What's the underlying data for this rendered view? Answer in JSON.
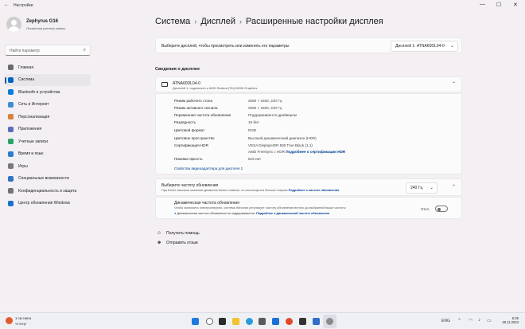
{
  "window": {
    "title": "Настройки",
    "back_glyph": "←",
    "controls": [
      "—",
      "☐",
      "✕"
    ]
  },
  "profile": {
    "name": "Zephyrus G16",
    "account_type": "Локальная учетная запись"
  },
  "search": {
    "placeholder": "Найти параметр"
  },
  "nav": [
    {
      "label": "Главная",
      "icon": "home-icon",
      "color": "#6b6b6b"
    },
    {
      "label": "Система",
      "icon": "system-icon",
      "color": "#0067c0",
      "active": true
    },
    {
      "label": "Bluetooth и устройства",
      "icon": "bluetooth-icon",
      "color": "#0a7bd6"
    },
    {
      "label": "Сеть и Интернет",
      "icon": "network-icon",
      "color": "#3b8fd6"
    },
    {
      "label": "Персонализация",
      "icon": "brush-icon",
      "color": "#d6833b"
    },
    {
      "label": "Приложения",
      "icon": "apps-icon",
      "color": "#5b6bb8"
    },
    {
      "label": "Учетные записи",
      "icon": "accounts-icon",
      "color": "#2aa36b"
    },
    {
      "label": "Время и язык",
      "icon": "globe-clock-icon",
      "color": "#2b7fd0"
    },
    {
      "label": "Игры",
      "icon": "gamepad-icon",
      "color": "#7a7a7a"
    },
    {
      "label": "Специальные возможности",
      "icon": "accessibility-icon",
      "color": "#2f73c6"
    },
    {
      "label": "Конфиденциальность и защита",
      "icon": "shield-icon",
      "color": "#737373"
    },
    {
      "label": "Центр обновления Windows",
      "icon": "update-icon",
      "color": "#1a73c9"
    }
  ],
  "breadcrumb": [
    "Система",
    "Дисплей",
    "Расширенные настройки дисплея"
  ],
  "breadcrumb_sep": "›",
  "display_select": {
    "label": "Выберите дисплей, чтобы просмотреть или изменить его параметры",
    "value": "Дисплей 1: ATNA60DL04-0"
  },
  "info": {
    "section_title": "Сведения о дисплее",
    "name": "ATNA60DL04-0",
    "subtitle": "Дисплей 1: подключен к AMD Radeon(TM) 890M Graphics",
    "rows": [
      {
        "label": "Режим рабочего стола",
        "value": "2560 × 1600, 240 Гц"
      },
      {
        "label": "Режим активного сигнала",
        "value": "2560 × 1600, 240 Гц"
      },
      {
        "label": "Переменная частота обновления",
        "value": "Поддерживается драйвером"
      },
      {
        "label": "Разрядность",
        "value": "10-бит"
      },
      {
        "label": "Цветовой формат",
        "value": "RGB"
      },
      {
        "label": "Цветовое пространство",
        "value": "Высокий динамический диапазон (HDR)"
      },
      {
        "label": "Сертификация HDR",
        "value": "VESA DisplayHDR 500 True Black (1.1)"
      },
      {
        "label": "",
        "value": "AMD FreeSync с HDR",
        "link": "Подробнее о сертификации HDR"
      },
      {
        "label": "Пиковая яркость",
        "value": "616 нит"
      }
    ],
    "adapter_link": "Свойства видеоадаптера для дисплея 1"
  },
  "refresh": {
    "title": "Выберите частоту обновления",
    "desc": "При более высоком значении движение более плавное, но используется больше энергии",
    "desc_link": "Подробнее о частоте обновления",
    "value": "240 Гц"
  },
  "dynamic": {
    "title": "Динамическая частота обновления",
    "desc": "Чтобы экономить электроэнергию, система Windows регулирует частоту обновления вплоть до выбранной выше частоты",
    "warning": "Динамическая частота обновления не поддерживается.",
    "warning_link": "Подробнее о динамической частоте обновления",
    "toggle_label": "Откл.",
    "toggle_on": false
  },
  "help": [
    {
      "label": "Получить помощь",
      "icon": "help-icon"
    },
    {
      "label": "Отправить отзыв",
      "icon": "feedback-icon"
    }
  ],
  "taskbar": {
    "weather_temp": "1 см снега",
    "weather_sub": "четверг",
    "time": "5:25",
    "date": "28.11.2024",
    "tray_lang": "ENG"
  }
}
